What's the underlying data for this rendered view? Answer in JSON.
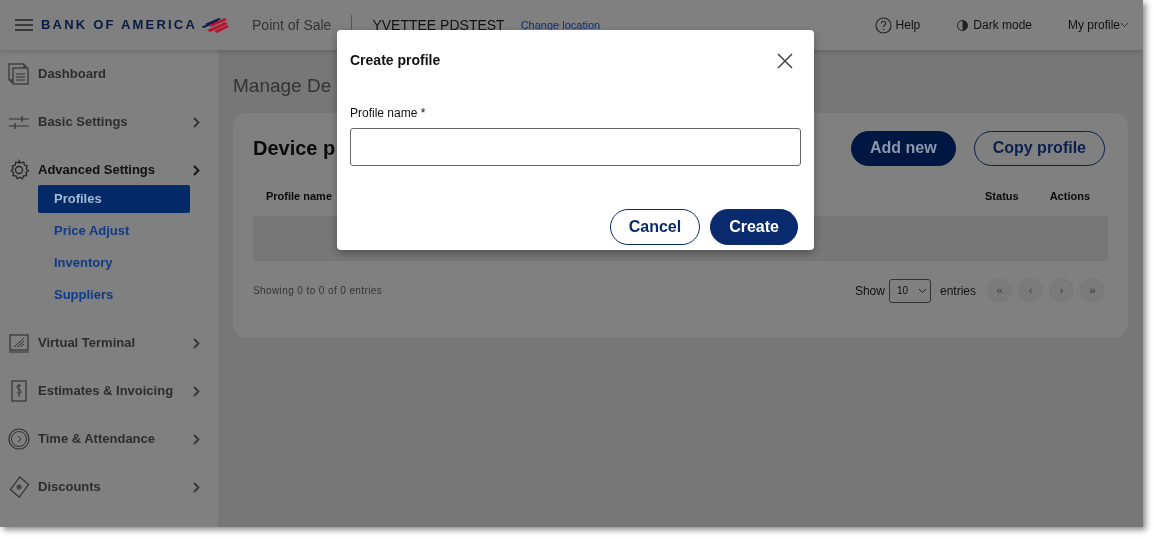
{
  "header": {
    "brand": "BANK OF AMERICA",
    "app_name": "Point of Sale",
    "location": "YVETTEE PDSTEST",
    "change_location": "Change location",
    "help": "Help",
    "dark_mode": "Dark mode",
    "profile": "My profile"
  },
  "sidebar": {
    "items": [
      {
        "label": "Dashboard",
        "expandable": false,
        "expanded": false
      },
      {
        "label": "Basic Settings",
        "expandable": true,
        "expanded": false
      },
      {
        "label": "Advanced Settings",
        "expandable": true,
        "expanded": true,
        "children": [
          {
            "label": "Profiles",
            "selected": true
          },
          {
            "label": "Price Adjust",
            "selected": false
          },
          {
            "label": "Inventory",
            "selected": false
          },
          {
            "label": "Suppliers",
            "selected": false
          }
        ]
      },
      {
        "label": "Virtual Terminal",
        "expandable": true,
        "expanded": false
      },
      {
        "label": "Estimates & Invoicing",
        "expandable": true,
        "expanded": false
      },
      {
        "label": "Time & Attendance",
        "expandable": true,
        "expanded": false
      },
      {
        "label": "Discounts",
        "expandable": true,
        "expanded": false
      }
    ]
  },
  "page": {
    "title": "Manage De",
    "card_title": "Device p",
    "buttons": [
      "Add new",
      "Copy profile"
    ],
    "table": {
      "columns": [
        "Profile name",
        "Status",
        "Actions"
      ]
    },
    "info": "Showing 0 to 0 of 0 entries",
    "show_label": "Show",
    "page_size": "10",
    "entries_label": "entries",
    "pagination": [
      "«",
      "‹",
      "›",
      "»"
    ]
  },
  "modal": {
    "title": "Create profile",
    "field_label": "Profile name *",
    "buttons": [
      "Cancel",
      "Create"
    ]
  }
}
